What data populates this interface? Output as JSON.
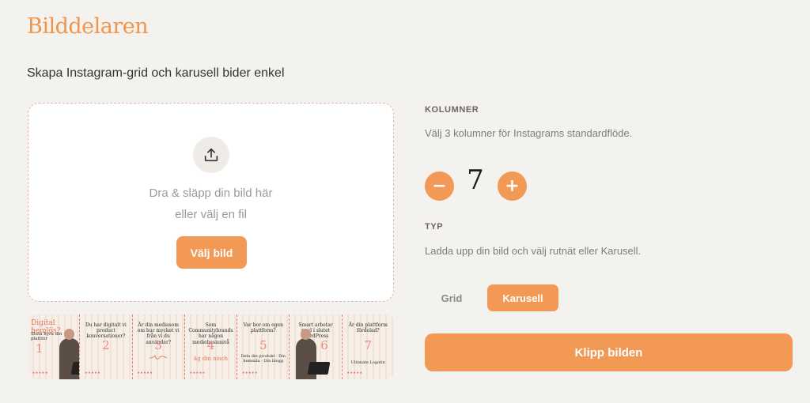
{
  "app": {
    "logo": "Bilddelaren",
    "subtitle": "Skapa Instagram-grid och karusell bider enkel"
  },
  "upload": {
    "icon": "upload-icon",
    "line1": "Dra & släpp din bild här",
    "line2": "eller välj en fil",
    "button_label": "Välj bild"
  },
  "preview": {
    "slides": [
      {
        "title": "Digital hemlös?",
        "subtitle": "Sluta hyra din plattfor",
        "number": "1"
      },
      {
        "title": "Du har digitalt vi product konversationer?",
        "number": "2"
      },
      {
        "title": "Är din mediasom om hur mycket vi från vi du använder?",
        "number": "3"
      },
      {
        "title": "Som Communitybrands har någon mediebasisnivå",
        "number": "4",
        "extra": "äg din nisch"
      },
      {
        "title": "Var bor om egen plattform?",
        "number": "5",
        "extra": "Dela din produkt · Din hemsida · Din blogg"
      },
      {
        "title": "Smart arbetar med i slutet WordPress",
        "number": "6"
      },
      {
        "title": "Är din plattform fördelad?",
        "number": "7",
        "extra": "Ultimate Logotin"
      }
    ]
  },
  "columns": {
    "heading": "KOLUMNER",
    "description": "Välj 3 kolumner för Instagrams standardflöde.",
    "value": "7",
    "minus_label": "−",
    "plus_label": "+"
  },
  "type": {
    "heading": "TYP",
    "description": "Ladda upp din bild och välj rutnät eller Karusell.",
    "options": [
      "Grid",
      "Karusell"
    ],
    "selected": "Karusell"
  },
  "action": {
    "cut_label": "Klipp bilden"
  },
  "colors": {
    "accent": "#f29a55",
    "background": "#f4f2ee",
    "logo": "#f0954b"
  }
}
